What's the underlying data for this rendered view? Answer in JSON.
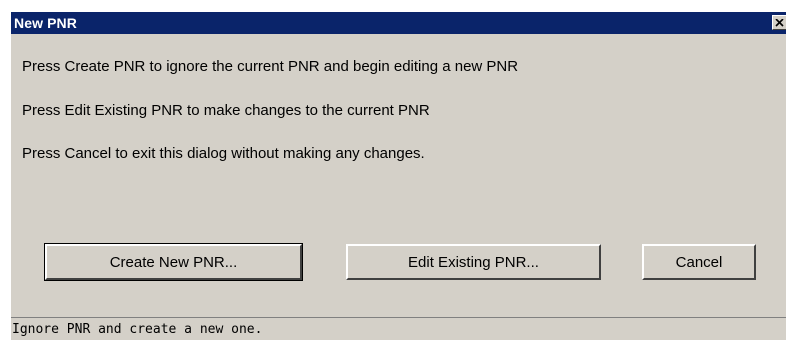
{
  "window": {
    "title": "New PNR",
    "close_icon": "close-icon"
  },
  "messages": [
    "Press Create PNR to ignore the current PNR and begin editing a new PNR",
    "Press Edit Existing PNR to make changes to the current PNR",
    "Press Cancel to exit this dialog without making any changes."
  ],
  "buttons": {
    "create": "Create New PNR...",
    "edit": "Edit Existing PNR...",
    "cancel": "Cancel"
  },
  "status": {
    "text": "Ignore PNR and create a new one."
  },
  "colors": {
    "titlebar": "#0a246a",
    "face": "#d4d0c8"
  }
}
